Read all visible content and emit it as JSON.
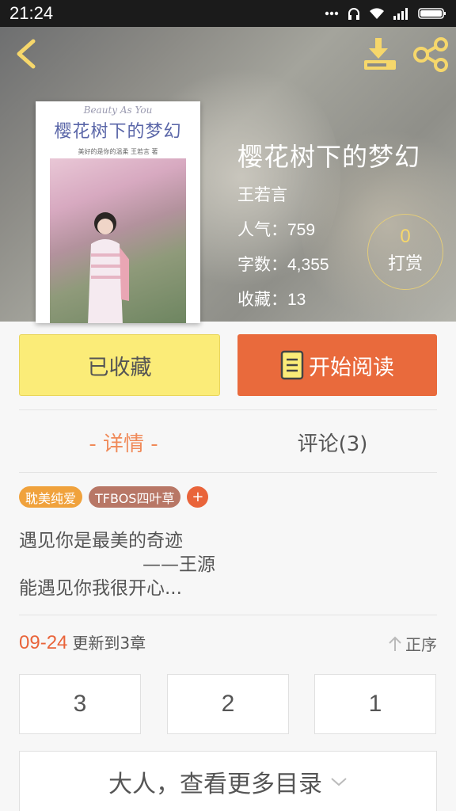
{
  "status_bar": {
    "time": "21:24",
    "icons": [
      "more-dots-icon",
      "headset-icon",
      "wifi-icon",
      "signal-icon",
      "battery-icon"
    ]
  },
  "header": {
    "back_icon": "chevron-left-icon",
    "download_icon": "download-icon",
    "share_icon": "share-icon"
  },
  "cover": {
    "script_text": "Beauty As You",
    "title": "樱花树下的梦幻",
    "subtitle": "美好的是你的温柔   王若言 著"
  },
  "book": {
    "title": "樱花树下的梦幻",
    "author": "王若言",
    "popularity_label": "人气：",
    "popularity": "759",
    "words_label": "字数：",
    "words": "4,355",
    "favorites_label": "收藏：",
    "favorites": "13"
  },
  "reward": {
    "count": "0",
    "label": "打赏"
  },
  "actions": {
    "favorited_label": "已收藏",
    "read_label": "开始阅读",
    "read_icon": "book-icon"
  },
  "tabs": {
    "detail": "- 详情 -",
    "comments": "评论(3)"
  },
  "tags": [
    "耽美纯爱",
    "TFBOS四叶草"
  ],
  "tag_add": "+",
  "description": {
    "line1": "遇见你是最美的奇迹",
    "line2": "——王源",
    "line3": "能遇见你我很开心..."
  },
  "update": {
    "date": "09-24",
    "text": "更新到3章",
    "sort_label": "正序"
  },
  "chapters": [
    "3",
    "2",
    "1"
  ],
  "more_catalog": "大人，查看更多目录",
  "colors": {
    "accent_orange": "#e96a3c",
    "fav_yellow": "#fbec78",
    "icon_yellow": "#f6d76b"
  }
}
